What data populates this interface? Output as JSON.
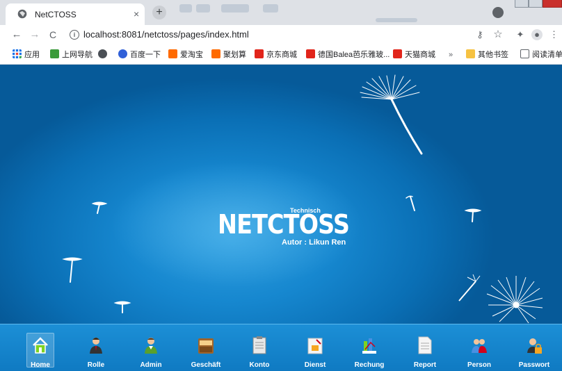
{
  "browser": {
    "tab_title": "NetCTOSS",
    "tab_close": "×",
    "new_tab": "+",
    "url": "localhost:8081/netctoss/pages/index.html"
  },
  "bookmarks": {
    "apps": "应用",
    "items": [
      {
        "label": "上网导航",
        "color": "#3a9a3a"
      },
      {
        "label": "",
        "color": "#4a4f55"
      },
      {
        "label": "百度一下",
        "color": "#3060d8"
      },
      {
        "label": "爱淘宝",
        "color": "#ff6a00"
      },
      {
        "label": "聚划算",
        "color": "#ff6a00"
      },
      {
        "label": "京东商城",
        "color": "#e1251b"
      },
      {
        "label": "德国Balea芭乐雅玻...",
        "color": "#e1251b"
      },
      {
        "label": "天猫商城",
        "color": "#e1251b"
      }
    ],
    "more": "»",
    "other": "其他书签",
    "reading": "阅读清单"
  },
  "page": {
    "logo_net": "NETCTOSS",
    "logo_technisch": "Technisch",
    "author": "Autor : Likun Ren",
    "background_color": "#1687cf"
  },
  "dock": {
    "items": [
      {
        "label": "Home",
        "icon": "home-icon"
      },
      {
        "label": "Rolle",
        "icon": "role-icon"
      },
      {
        "label": "Admin",
        "icon": "admin-icon"
      },
      {
        "label": "Geschäft",
        "icon": "business-icon"
      },
      {
        "label": "Konto",
        "icon": "account-icon"
      },
      {
        "label": "Dienst",
        "icon": "service-icon"
      },
      {
        "label": "Rechung",
        "icon": "bill-icon"
      },
      {
        "label": "Report",
        "icon": "report-icon"
      },
      {
        "label": "Person",
        "icon": "person-icon"
      },
      {
        "label": "Passwort",
        "icon": "password-icon"
      }
    ]
  }
}
